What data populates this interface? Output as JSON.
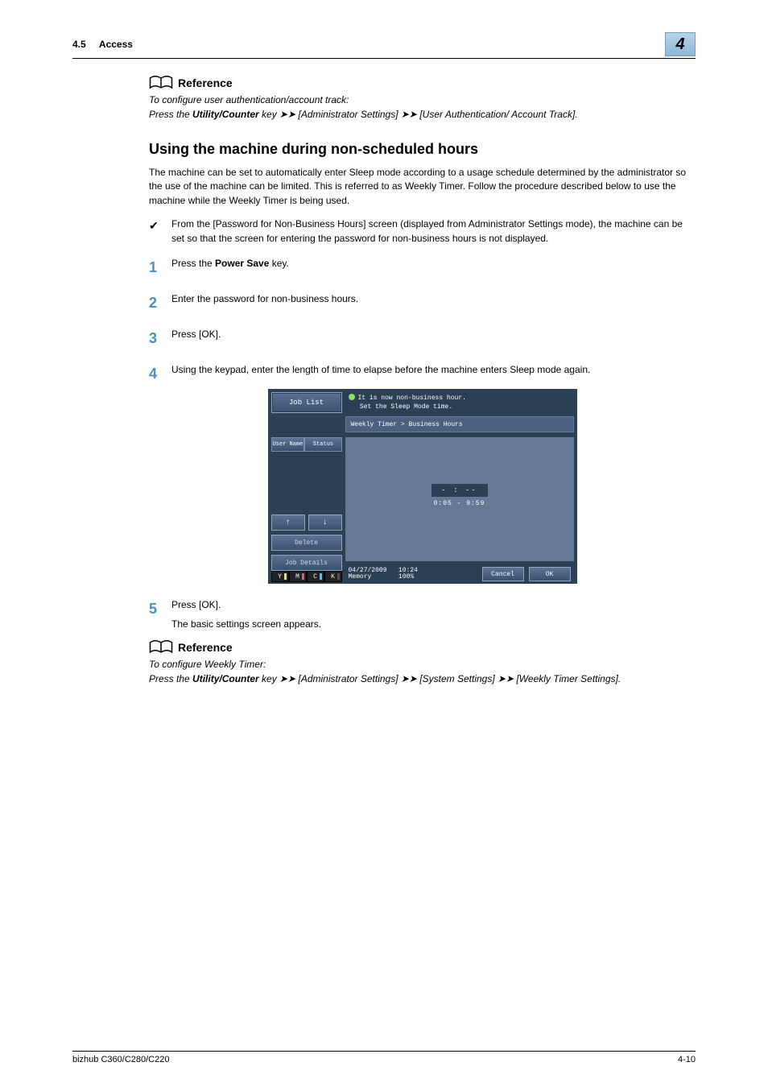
{
  "header": {
    "section_num": "4.5",
    "section_title": "Access",
    "chapter": "4"
  },
  "ref1": {
    "heading": "Reference",
    "line1": "To configure user authentication/account track:",
    "line2_pre": "Press the ",
    "line2_key": "Utility/Counter",
    "line2_post": " key ➤➤ [Administrator Settings] ➤➤ [User Authentication/ Account Track]."
  },
  "heading2": "Using the machine during non-scheduled hours",
  "para1": "The machine can be set to automatically enter Sleep mode according to a usage schedule determined by the administrator so the use of the machine can be limited. This is referred to as Weekly Timer. Follow the procedure described below to use the machine while the Weekly Timer is being used.",
  "check1": "From the [Password for Non-Business Hours] screen (displayed from Administrator Settings mode), the machine can be set so that the screen for entering the password for non-business hours is not displayed.",
  "steps": {
    "s1_pre": "Press the ",
    "s1_bold": "Power Save",
    "s1_post": " key.",
    "s2": "Enter the password for non-business hours.",
    "s3": "Press [OK].",
    "s4": "Using the keypad, enter the length of time to elapse before the machine enters Sleep mode again.",
    "s5": "Press [OK].",
    "s5_sub": "The basic settings screen appears."
  },
  "screenshot": {
    "joblist": "Job List",
    "tab_user": "User Name",
    "tab_status": "Status",
    "up": "↑",
    "down": "↓",
    "delete": "Delete",
    "details": "Job Details",
    "toner": {
      "y": "Y",
      "m": "M",
      "c": "C",
      "k": "K"
    },
    "msg_line1": "It is now non-business hour.",
    "msg_line2": "Set the Sleep Mode time.",
    "breadcrumb": "Weekly Timer > Business Hours",
    "value": "- : --",
    "range": "0:05 - 9:59",
    "date": "04/27/2009",
    "time": "10:24",
    "mem_label": "Memory",
    "mem_val": "100%",
    "cancel": "Cancel",
    "ok": "OK"
  },
  "ref2": {
    "heading": "Reference",
    "line1": "To configure Weekly Timer:",
    "line2_pre": "Press the ",
    "line2_key": "Utility/Counter",
    "line2_post": " key ➤➤ [Administrator Settings] ➤➤ [System Settings] ➤➤ [Weekly Timer Settings]."
  },
  "footer": {
    "model": "bizhub C360/C280/C220",
    "page": "4-10"
  }
}
